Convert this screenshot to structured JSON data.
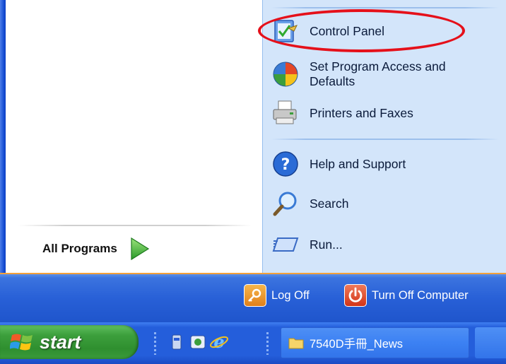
{
  "left_pane": {
    "all_programs": {
      "label": "All Programs",
      "icon": "green-arrow-icon"
    }
  },
  "right_pane": {
    "items": [
      {
        "id": "control-panel",
        "label": "Control Panel",
        "icon": "control-panel-icon"
      },
      {
        "id": "set-program-access",
        "label": "Set Program Access and Defaults",
        "icon": "windows-globe-icon"
      },
      {
        "id": "printers-faxes",
        "label": "Printers and Faxes",
        "icon": "printer-icon"
      },
      {
        "id": "help-support",
        "label": "Help and Support",
        "icon": "help-icon"
      },
      {
        "id": "search",
        "label": "Search",
        "icon": "magnifier-icon"
      },
      {
        "id": "run",
        "label": "Run...",
        "icon": "run-icon"
      }
    ]
  },
  "bottom_bar": {
    "log_off": "Log Off",
    "turn_off": "Turn Off Computer"
  },
  "taskbar": {
    "start_label": "start",
    "quick_launch": [
      "show-desktop-icon",
      "media-icon",
      "internet-explorer-icon"
    ],
    "task_button_label": "7540D手冊_News"
  },
  "colors": {
    "highlight_ring": "#e5101a",
    "right_pane_bg": "#d3e5fa",
    "taskbar_blue": "#245edb",
    "start_green": "#3c9f3c"
  }
}
